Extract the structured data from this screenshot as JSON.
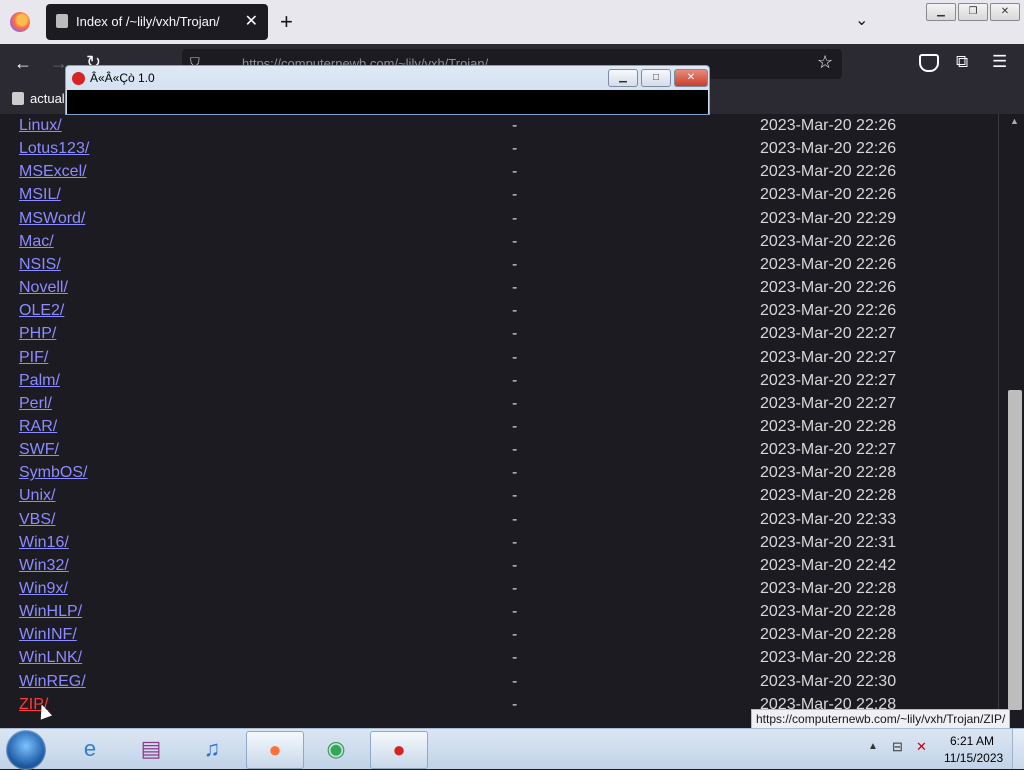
{
  "browser": {
    "tab_title": "Index of /~lily/vxh/Trojan/",
    "tab_close": "✕",
    "new_tab": "+",
    "tab_list": "⌄",
    "url": "https://computernewb.com/~lily/vxh/Trojan/",
    "bookmark_label": "actual",
    "star": "☆",
    "ext": "⧉",
    "menu": "☰"
  },
  "window_controls": {
    "minimize": "▁",
    "restore": "❐",
    "close": "✕"
  },
  "popup": {
    "title": "Â«Â«Çò 1.0",
    "minimize": "▁",
    "maximize": "□",
    "close": "✕"
  },
  "listing": {
    "rows": [
      {
        "name": "Linux/",
        "size": "-",
        "date": "2023-Mar-20 22:26"
      },
      {
        "name": "Lotus123/",
        "size": "-",
        "date": "2023-Mar-20 22:26"
      },
      {
        "name": "MSExcel/",
        "size": "-",
        "date": "2023-Mar-20 22:26"
      },
      {
        "name": "MSIL/",
        "size": "-",
        "date": "2023-Mar-20 22:26"
      },
      {
        "name": "MSWord/",
        "size": "-",
        "date": "2023-Mar-20 22:29"
      },
      {
        "name": "Mac/",
        "size": "-",
        "date": "2023-Mar-20 22:26"
      },
      {
        "name": "NSIS/",
        "size": "-",
        "date": "2023-Mar-20 22:26"
      },
      {
        "name": "Novell/",
        "size": "-",
        "date": "2023-Mar-20 22:26"
      },
      {
        "name": "OLE2/",
        "size": "-",
        "date": "2023-Mar-20 22:26"
      },
      {
        "name": "PHP/",
        "size": "-",
        "date": "2023-Mar-20 22:27"
      },
      {
        "name": "PIF/",
        "size": "-",
        "date": "2023-Mar-20 22:27"
      },
      {
        "name": "Palm/",
        "size": "-",
        "date": "2023-Mar-20 22:27"
      },
      {
        "name": "Perl/",
        "size": "-",
        "date": "2023-Mar-20 22:27"
      },
      {
        "name": "RAR/",
        "size": "-",
        "date": "2023-Mar-20 22:28"
      },
      {
        "name": "SWF/",
        "size": "-",
        "date": "2023-Mar-20 22:27"
      },
      {
        "name": "SymbOS/",
        "size": "-",
        "date": "2023-Mar-20 22:28"
      },
      {
        "name": "Unix/",
        "size": "-",
        "date": "2023-Mar-20 22:28"
      },
      {
        "name": "VBS/",
        "size": "-",
        "date": "2023-Mar-20 22:33"
      },
      {
        "name": "Win16/",
        "size": "-",
        "date": "2023-Mar-20 22:31"
      },
      {
        "name": "Win32/",
        "size": "-",
        "date": "2023-Mar-20 22:42"
      },
      {
        "name": "Win9x/",
        "size": "-",
        "date": "2023-Mar-20 22:28"
      },
      {
        "name": "WinHLP/",
        "size": "-",
        "date": "2023-Mar-20 22:28"
      },
      {
        "name": "WinINF/",
        "size": "-",
        "date": "2023-Mar-20 22:28"
      },
      {
        "name": "WinLNK/",
        "size": "-",
        "date": "2023-Mar-20 22:28"
      },
      {
        "name": "WinREG/",
        "size": "-",
        "date": "2023-Mar-20 22:30"
      },
      {
        "name": "ZIP/",
        "size": "-",
        "date": "2023-Mar-20 22:28"
      }
    ]
  },
  "status_url": "https://computernewb.com/~lily/vxh/Trojan/ZIP/",
  "taskbar": {
    "apps": [
      {
        "name": "ie-icon",
        "glyph": "e"
      },
      {
        "name": "winrar-icon",
        "glyph": "▤"
      },
      {
        "name": "itunes-icon",
        "glyph": "♫"
      },
      {
        "name": "firefox-icon",
        "glyph": "●"
      },
      {
        "name": "chrome-icon",
        "glyph": "◉"
      },
      {
        "name": "red-ball-icon",
        "glyph": "●"
      }
    ],
    "time": "6:21 AM",
    "date": "11/15/2023"
  },
  "colors": {
    "link": "#8c8cff",
    "active_link": "#ff3b3b",
    "page_bg": "#1c1b22"
  }
}
